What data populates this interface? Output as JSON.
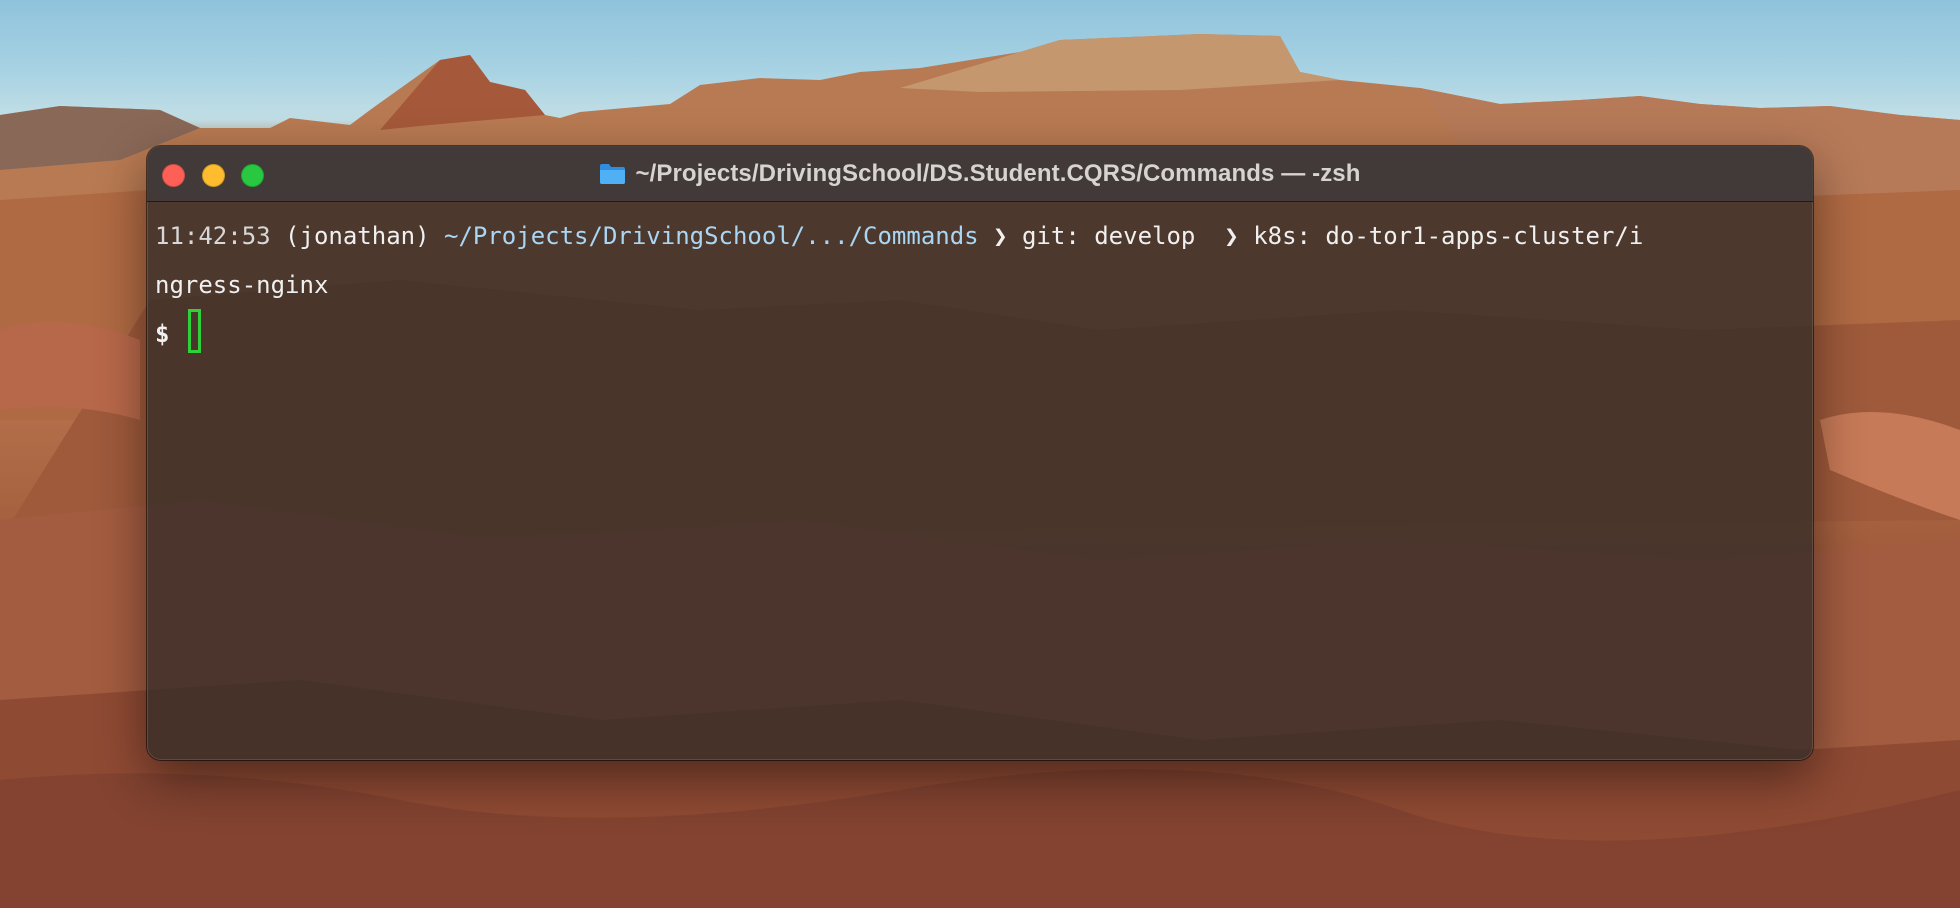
{
  "window": {
    "title": "~/Projects/DrivingSchool/DS.Student.CQRS/Commands — -zsh",
    "folder_icon": "folder-icon"
  },
  "prompt": {
    "time": "11:42:53",
    "user": "(jonathan)",
    "path": "~/Projects/DrivingSchool/.../Commands",
    "separator": "❯",
    "git_label": "git: develop",
    "k8s_label": "k8s: do-tor1-apps-cluster/i",
    "k8s_wrap": "ngress-nginx",
    "symbol": "$"
  },
  "colors": {
    "close": "#fe5f57",
    "minimize": "#febc2e",
    "zoom": "#28c840",
    "cursor": "#2ed13a",
    "path": "#a9d6f5"
  }
}
